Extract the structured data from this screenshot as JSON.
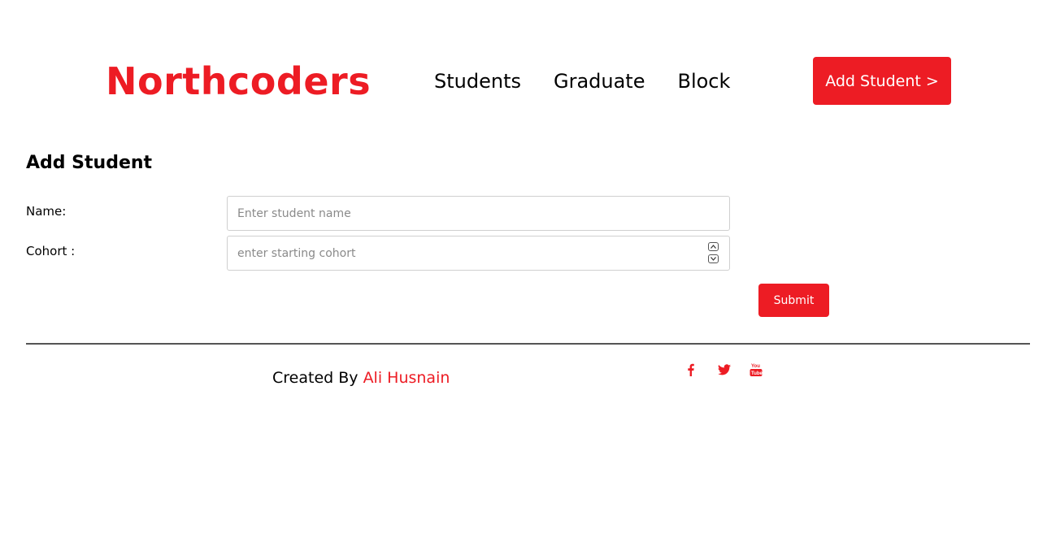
{
  "header": {
    "logo": "Northcoders",
    "nav": [
      "Students",
      "Graduate",
      "Block"
    ],
    "add_button": "Add Student >"
  },
  "form": {
    "title": "Add Student",
    "name_label": "Name:",
    "name_placeholder": "Enter student name",
    "cohort_label": "Cohort :",
    "cohort_placeholder": "enter starting cohort",
    "submit": "Submit"
  },
  "footer": {
    "created_by": "Created By ",
    "author": "Ali Husnain",
    "social": [
      "facebook-icon",
      "twitter-icon",
      "youtube-icon"
    ]
  },
  "colors": {
    "brand": "#ed1c24"
  }
}
